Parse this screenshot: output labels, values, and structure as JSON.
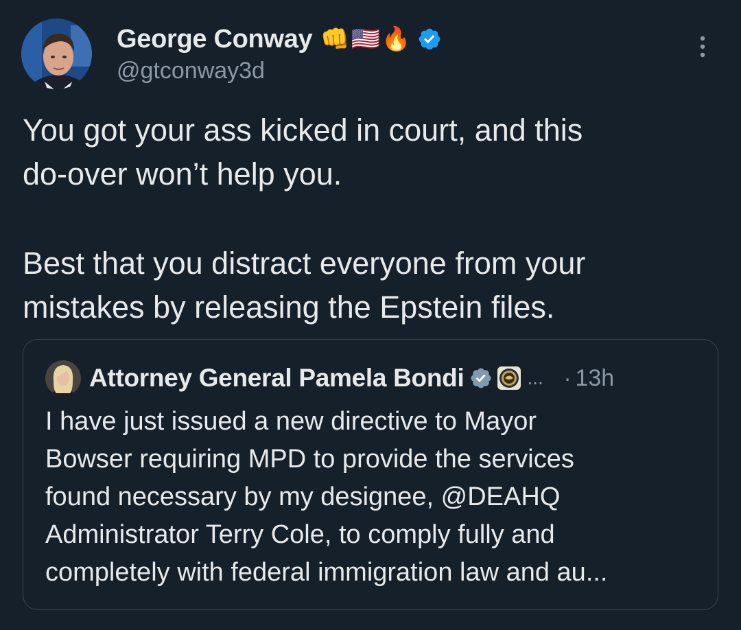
{
  "author": {
    "display_name": "George Conway",
    "emojis": [
      "👊",
      "🇺🇸",
      "🔥"
    ],
    "handle": "@gtconway3d",
    "verified": true,
    "verified_color": "#1d9bf0"
  },
  "tweet": {
    "paragraphs": [
      "You got your ass kicked in court, and this\ndo-over won’t help you.",
      "Best that you distract everyone from your\nmistakes by releasing the Epstein files."
    ]
  },
  "quoted_tweet": {
    "display_name": "Attorney General Pamela Bondi",
    "verified_badge_color": "#829aab",
    "ellipsis": "...",
    "separator": "·",
    "time": "13h",
    "text": "I have just issued a new directive to Mayor\nBowser requiring MPD to provide the services\nfound necessary by my designee, @DEAHQ\nAdministrator Terry Cole, to comply fully and\ncompletely with federal immigration law and au..."
  },
  "icons": {
    "more": "more-vertical-icon",
    "verified": "verified-badge-icon",
    "seal": "doj-seal-icon"
  },
  "colors": {
    "background": "#15202b",
    "text": "#e7e9ea",
    "secondary_text": "#8b98a5",
    "border": "#38444d"
  }
}
